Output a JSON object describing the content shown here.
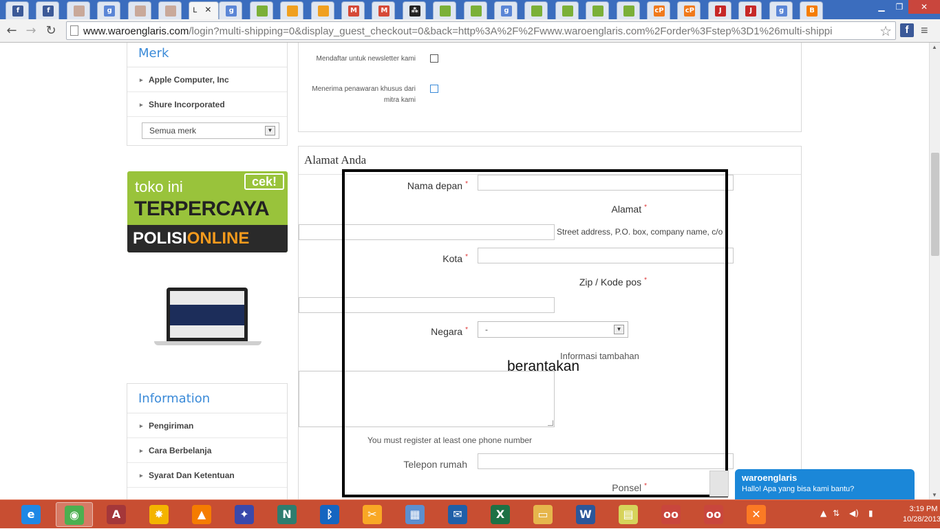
{
  "browser": {
    "active_tab_label": "L",
    "close_tab_glyph": "✕",
    "url_domain": "www.waroenglaris.com",
    "url_path": "/login?multi-shipping=0&display_guest_checkout=0&back=http%3A%2F%2Fwww.waroenglaris.com%2Forder%3Fstep%3D1%26multi-shippi",
    "tab_icons": [
      {
        "icon": "facebook-icon",
        "color": "#3b5998",
        "glyph": "f"
      },
      {
        "icon": "facebook-icon",
        "color": "#3b5998",
        "glyph": "f"
      },
      {
        "icon": "page-icon",
        "color": "#c9a99a",
        "glyph": ""
      },
      {
        "icon": "google-icon",
        "color": "#5b86d6",
        "glyph": "g"
      },
      {
        "icon": "page-icon",
        "color": "#c9a99a",
        "glyph": ""
      },
      {
        "icon": "page-icon",
        "color": "#c9a99a",
        "glyph": ""
      },
      {
        "icon": "google-icon",
        "color": "#5b86d6",
        "glyph": "g"
      },
      {
        "icon": "shop-icon",
        "color": "#7bb038",
        "glyph": ""
      },
      {
        "icon": "cart-icon",
        "color": "#f0a020",
        "glyph": ""
      },
      {
        "icon": "cart-icon",
        "color": "#f0a020",
        "glyph": ""
      },
      {
        "icon": "gmail-icon",
        "color": "#d64937",
        "glyph": "M"
      },
      {
        "icon": "gmail-icon",
        "color": "#d64937",
        "glyph": "M"
      },
      {
        "icon": "blackberry-icon",
        "color": "#222222",
        "glyph": "⁂"
      },
      {
        "icon": "shop-icon",
        "color": "#7bb038",
        "glyph": ""
      },
      {
        "icon": "shop-icon",
        "color": "#7bb038",
        "glyph": ""
      },
      {
        "icon": "google-icon",
        "color": "#5b86d6",
        "glyph": "g"
      },
      {
        "icon": "shop-icon",
        "color": "#7bb038",
        "glyph": ""
      },
      {
        "icon": "shop-icon",
        "color": "#7bb038",
        "glyph": ""
      },
      {
        "icon": "shop-icon",
        "color": "#7bb038",
        "glyph": ""
      },
      {
        "icon": "shop-icon",
        "color": "#7bb038",
        "glyph": ""
      },
      {
        "icon": "cpanel-icon",
        "color": "#f07a1d",
        "glyph": "cP"
      },
      {
        "icon": "cpanel-icon",
        "color": "#f07a1d",
        "glyph": "cP"
      },
      {
        "icon": "jne-icon",
        "color": "#c62828",
        "glyph": "J"
      },
      {
        "icon": "jne-icon",
        "color": "#c62828",
        "glyph": "J"
      },
      {
        "icon": "google-icon",
        "color": "#5b86d6",
        "glyph": "g"
      },
      {
        "icon": "blogger-icon",
        "color": "#f57d00",
        "glyph": "B"
      }
    ]
  },
  "sidebar": {
    "brands_title": "Merk",
    "brands": [
      "Apple Computer, Inc",
      "Shure Incorporated"
    ],
    "brand_select_value": "Semua merk",
    "banner": {
      "top": "toko ini",
      "badge": "cek!",
      "main": "TERPERCAYA",
      "bottom_white": "POLISI",
      "bottom_orange": "ONLINE"
    },
    "info_title": "Information",
    "info_items": [
      "Pengiriman",
      "Cara Berbelanja",
      "Syarat Dan Ketentuan"
    ]
  },
  "options_panel": {
    "newsletter_label": "Mendaftar untuk newsletter kami",
    "offers_label": "Menerima penawaran khusus dari mitra kami"
  },
  "address_panel": {
    "title": "Alamat Anda",
    "first_name_label": "Nama depan",
    "address_label": "Alamat",
    "address_hint": "Street address, P.O. box, company name, c/o",
    "city_label": "Kota",
    "zip_label": "Zip / Kode pos",
    "country_label": "Negara",
    "country_value": "-",
    "additional_info_label": "Informasi tambahan",
    "phone_note": "You must register at least one phone number",
    "home_phone_label": "Telepon rumah",
    "mobile_label": "Ponsel",
    "required_mark": "*"
  },
  "annotation": {
    "text": "berantakan"
  },
  "chat": {
    "name": "waroenglaris",
    "message": "Hallo! Apa yang bisa kami bantu?"
  },
  "taskbar": {
    "apps": [
      {
        "icon": "ie-icon",
        "color": "#1e88e5",
        "glyph": "e"
      },
      {
        "icon": "chrome-icon",
        "color": "#4caf50",
        "glyph": "◉"
      },
      {
        "icon": "access-icon",
        "color": "#a4373a",
        "glyph": "A"
      },
      {
        "icon": "media-icon",
        "color": "#f4b400",
        "glyph": "✸"
      },
      {
        "icon": "vlc-icon",
        "color": "#f57c00",
        "glyph": "▲"
      },
      {
        "icon": "stickies-icon",
        "color": "#3949ab",
        "glyph": "✦"
      },
      {
        "icon": "n-app-icon",
        "color": "#2e7d6f",
        "glyph": "N"
      },
      {
        "icon": "bluetooth-icon",
        "color": "#1565c0",
        "glyph": "ᛒ"
      },
      {
        "icon": "tools-icon",
        "color": "#f9a825",
        "glyph": "✂"
      },
      {
        "icon": "control-panel-icon",
        "color": "#5c8fcf",
        "glyph": "▦"
      },
      {
        "icon": "thunderbird-icon",
        "color": "#1f5fa8",
        "glyph": "✉"
      },
      {
        "icon": "excel-icon",
        "color": "#1e7145",
        "glyph": "X"
      },
      {
        "icon": "folder-icon",
        "color": "#e6b64c",
        "glyph": "▭"
      },
      {
        "icon": "word-icon",
        "color": "#2b579a",
        "glyph": "W"
      },
      {
        "icon": "sticky-notes-icon",
        "color": "#d6d35a",
        "glyph": "▤"
      },
      {
        "icon": "flickr-icon",
        "color": "#c9463d",
        "glyph": "oo"
      },
      {
        "icon": "flickr-icon",
        "color": "#c9463d",
        "glyph": "oo"
      },
      {
        "icon": "xampp-icon",
        "color": "#fb7a24",
        "glyph": "✕"
      }
    ],
    "tray_up": "▲",
    "tray_sync": "⇅",
    "tray_volume": "◀)",
    "tray_signal": "▮",
    "time": "3:19 PM",
    "date": "10/28/2013"
  }
}
